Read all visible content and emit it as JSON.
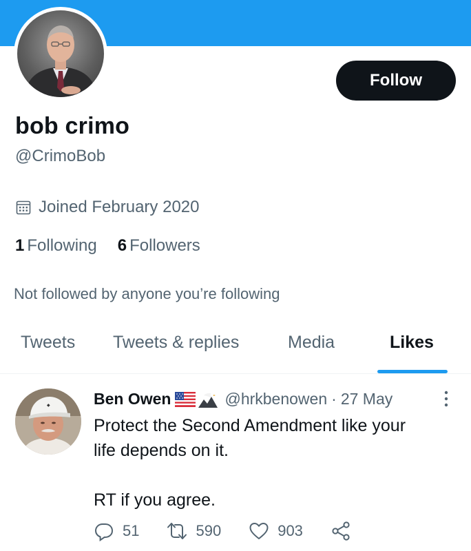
{
  "profile": {
    "display_name": "bob crimo",
    "handle": "@CrimoBob",
    "joined": "Joined February 2020",
    "following_count": "1",
    "following_label": "Following",
    "followers_count": "6",
    "followers_label": "Followers",
    "not_followed_text": "Not followed by anyone you’re following"
  },
  "actions": {
    "follow_label": "Follow"
  },
  "tabs": [
    {
      "label": "Tweets"
    },
    {
      "label": "Tweets & replies"
    },
    {
      "label": "Media"
    },
    {
      "label": "Likes"
    }
  ],
  "active_tab": "Likes",
  "tweet": {
    "author_name": "Ben Owen",
    "author_handle": "@hrkbenowen",
    "separator": "·",
    "date": "27 May",
    "text": "Protect the Second Amendment like your\nlife depends on it.\n\nRT if you agree.",
    "reply_count": "51",
    "retweet_count": "590",
    "like_count": "903",
    "badges": [
      "us-flag-emoji",
      "eagle-mountain-emoji"
    ]
  },
  "colors": {
    "banner": "#1d9bf0",
    "accent": "#1d9bf0",
    "text_primary": "#0f1419",
    "text_secondary": "#536471",
    "follow_button_bg": "#0f1419"
  },
  "icons": {
    "joined": "calendar-icon",
    "reply": "reply-icon",
    "retweet": "retweet-icon",
    "like": "heart-icon",
    "share": "share-icon",
    "more": "more-options-icon"
  }
}
